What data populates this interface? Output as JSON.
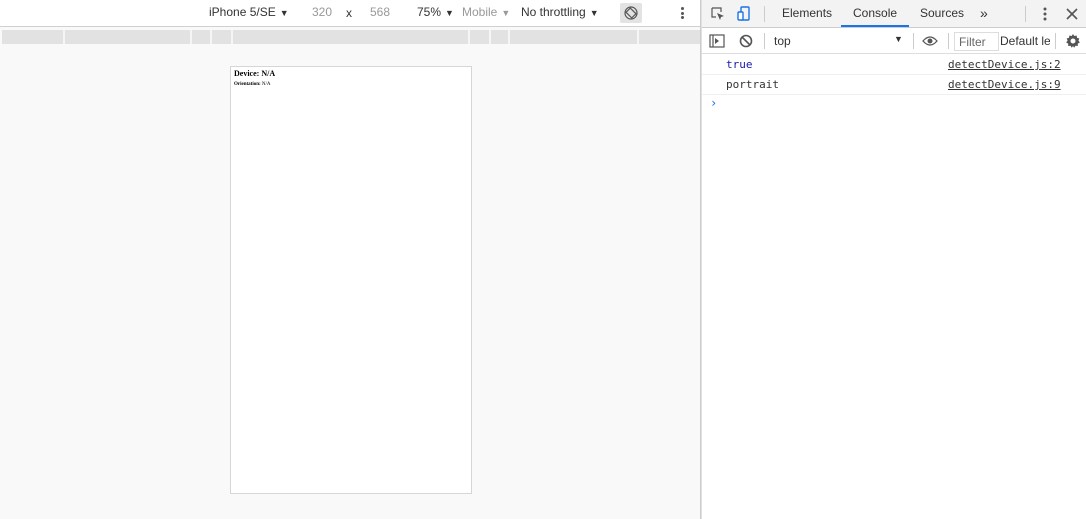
{
  "emulator": {
    "device": "iPhone 5/SE",
    "width": "320",
    "times": "x",
    "height": "568",
    "zoom": "75%",
    "mode": "Mobile",
    "throttling": "No throttling"
  },
  "page": {
    "device_label": "Device: N/A",
    "orientation_label": "Orientation:",
    "orientation_value": "N/A"
  },
  "devtools": {
    "tabs": [
      "Elements",
      "Console",
      "Sources"
    ],
    "more_tabs": "»",
    "active_tab": "Console",
    "context": "top",
    "filter_placeholder": "Filter",
    "levels": "Default le",
    "logs": [
      {
        "message": "true",
        "source": "detectDevice.js:2"
      },
      {
        "message": "portrait",
        "source": "detectDevice.js:9"
      }
    ],
    "prompt": "›"
  },
  "colors": {
    "accent": "#1a73e8",
    "bool_value": "#1a1aa6"
  }
}
